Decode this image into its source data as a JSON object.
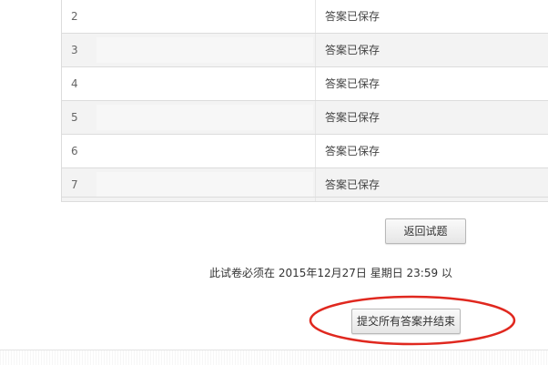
{
  "answers_table": {
    "rows": [
      {
        "number": "2",
        "status": "答案已保存"
      },
      {
        "number": "3",
        "status": "答案已保存"
      },
      {
        "number": "4",
        "status": "答案已保存"
      },
      {
        "number": "5",
        "status": "答案已保存"
      },
      {
        "number": "6",
        "status": "答案已保存"
      },
      {
        "number": "7",
        "status": "答案已保存"
      }
    ]
  },
  "back_button_label": "返回试题",
  "deadline_text": "此试卷必须在 2015年12月27日 星期日 23:59 以",
  "submit_button_label": "提交所有答案并结束",
  "annotation_color": "#e0281f"
}
